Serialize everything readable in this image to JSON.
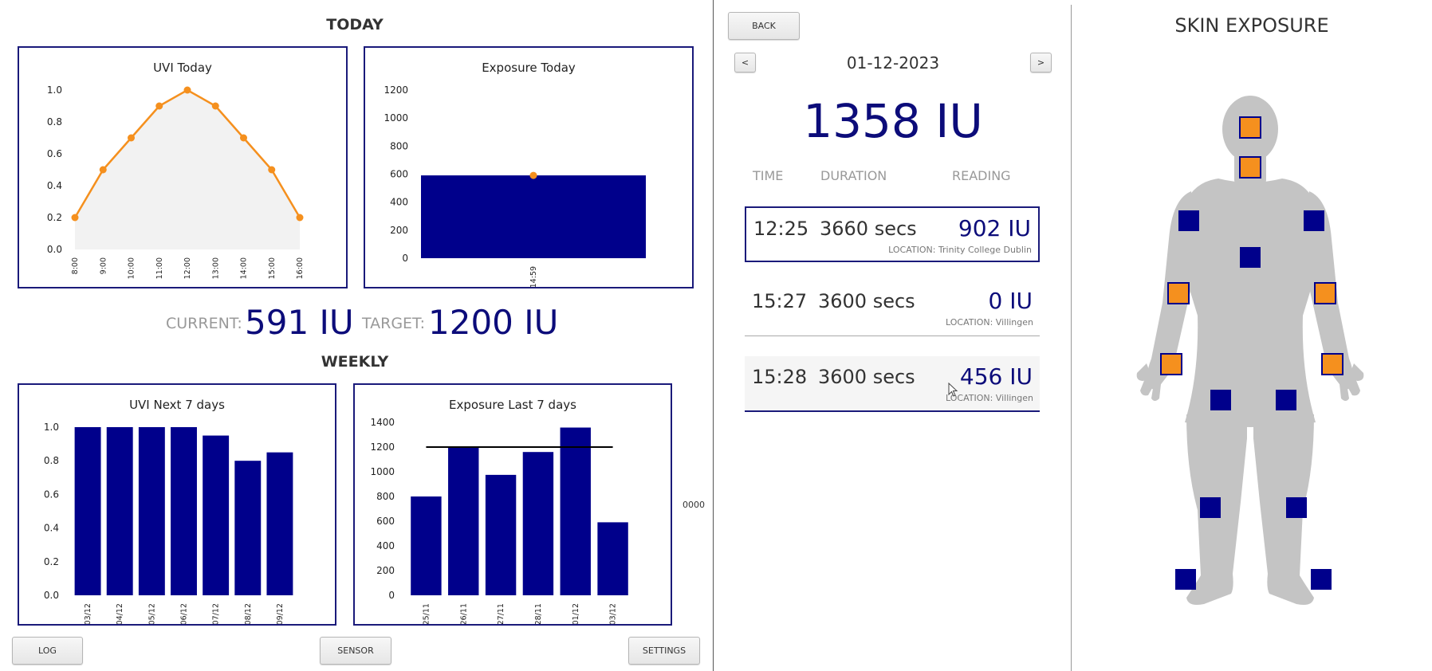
{
  "today": {
    "title": "TODAY",
    "uvi_chart": {
      "type": "line",
      "title": "UVI Today",
      "x": [
        "8:00",
        "9:00",
        "10:00",
        "11:00",
        "12:00",
        "13:00",
        "14:00",
        "15:00",
        "16:00"
      ],
      "values": [
        0.2,
        0.5,
        0.7,
        0.9,
        1.0,
        0.9,
        0.7,
        0.5,
        0.2
      ],
      "yticks": [
        "0.0",
        "0.2",
        "0.4",
        "0.6",
        "0.8",
        "1.0"
      ],
      "ylim": [
        0,
        1.0
      ],
      "line_color": "#f5901e",
      "fill_color": "#f2f2f2"
    },
    "exposure_chart": {
      "type": "bar",
      "title": "Exposure Today",
      "categories": [
        "14:59"
      ],
      "values": [
        591
      ],
      "yticks": [
        "0",
        "200",
        "400",
        "600",
        "800",
        "1000",
        "1200"
      ],
      "ylim": [
        0,
        1200
      ],
      "bar_color": "#00008b",
      "marker_color": "#f5901e"
    },
    "current_label": "CURRENT:",
    "current_value": "591 IU",
    "target_label": "TARGET:",
    "target_value": "1200 IU"
  },
  "weekly": {
    "title": "WEEKLY",
    "uvi_chart": {
      "type": "bar",
      "title": "UVI Next 7 days",
      "categories": [
        "03/12",
        "04/12",
        "05/12",
        "06/12",
        "07/12",
        "08/12",
        "09/12"
      ],
      "values": [
        1.0,
        1.0,
        1.0,
        1.0,
        0.95,
        0.8,
        0.85
      ],
      "yticks": [
        "0.0",
        "0.2",
        "0.4",
        "0.6",
        "0.8",
        "1.0"
      ],
      "ylim": [
        0,
        1.0
      ],
      "bar_color": "#00008b"
    },
    "exposure_chart": {
      "type": "bar",
      "title": "Exposure Last 7 days",
      "categories": [
        "25/11",
        "26/11",
        "27/11",
        "28/11",
        "01/12",
        "03/12"
      ],
      "values": [
        800,
        1200,
        975,
        1160,
        1358,
        591
      ],
      "target": 1200,
      "yticks": [
        "0",
        "200",
        "400",
        "600",
        "800",
        "1000",
        "1200",
        "1400"
      ],
      "ylim": [
        0,
        1400
      ],
      "bar_color": "#00008b",
      "side_label": "0000"
    }
  },
  "buttons": {
    "log": "LOG",
    "sensor": "SENSOR",
    "settings": "SETTINGS",
    "back": "BACK",
    "prev": "<",
    "next": ">"
  },
  "detail": {
    "date": "01-12-2023",
    "total": "1358 IU",
    "headers": {
      "time": "TIME",
      "duration": "DURATION",
      "reading": "READING"
    },
    "entries": [
      {
        "time": "12:25",
        "duration": "3660 secs",
        "reading": "902 IU",
        "location": "LOCATION: Trinity College Dublin"
      },
      {
        "time": "15:27",
        "duration": "3600 secs",
        "reading": "0 IU",
        "location": "LOCATION: Villingen"
      },
      {
        "time": "15:28",
        "duration": "3600 secs",
        "reading": "456 IU",
        "location": "LOCATION: Villingen"
      }
    ]
  },
  "skin": {
    "title": "SKIN EXPOSURE",
    "body_color": "#c4c4c4",
    "exposed_color": "#f5901e",
    "unexposed_color": "#00008b"
  }
}
